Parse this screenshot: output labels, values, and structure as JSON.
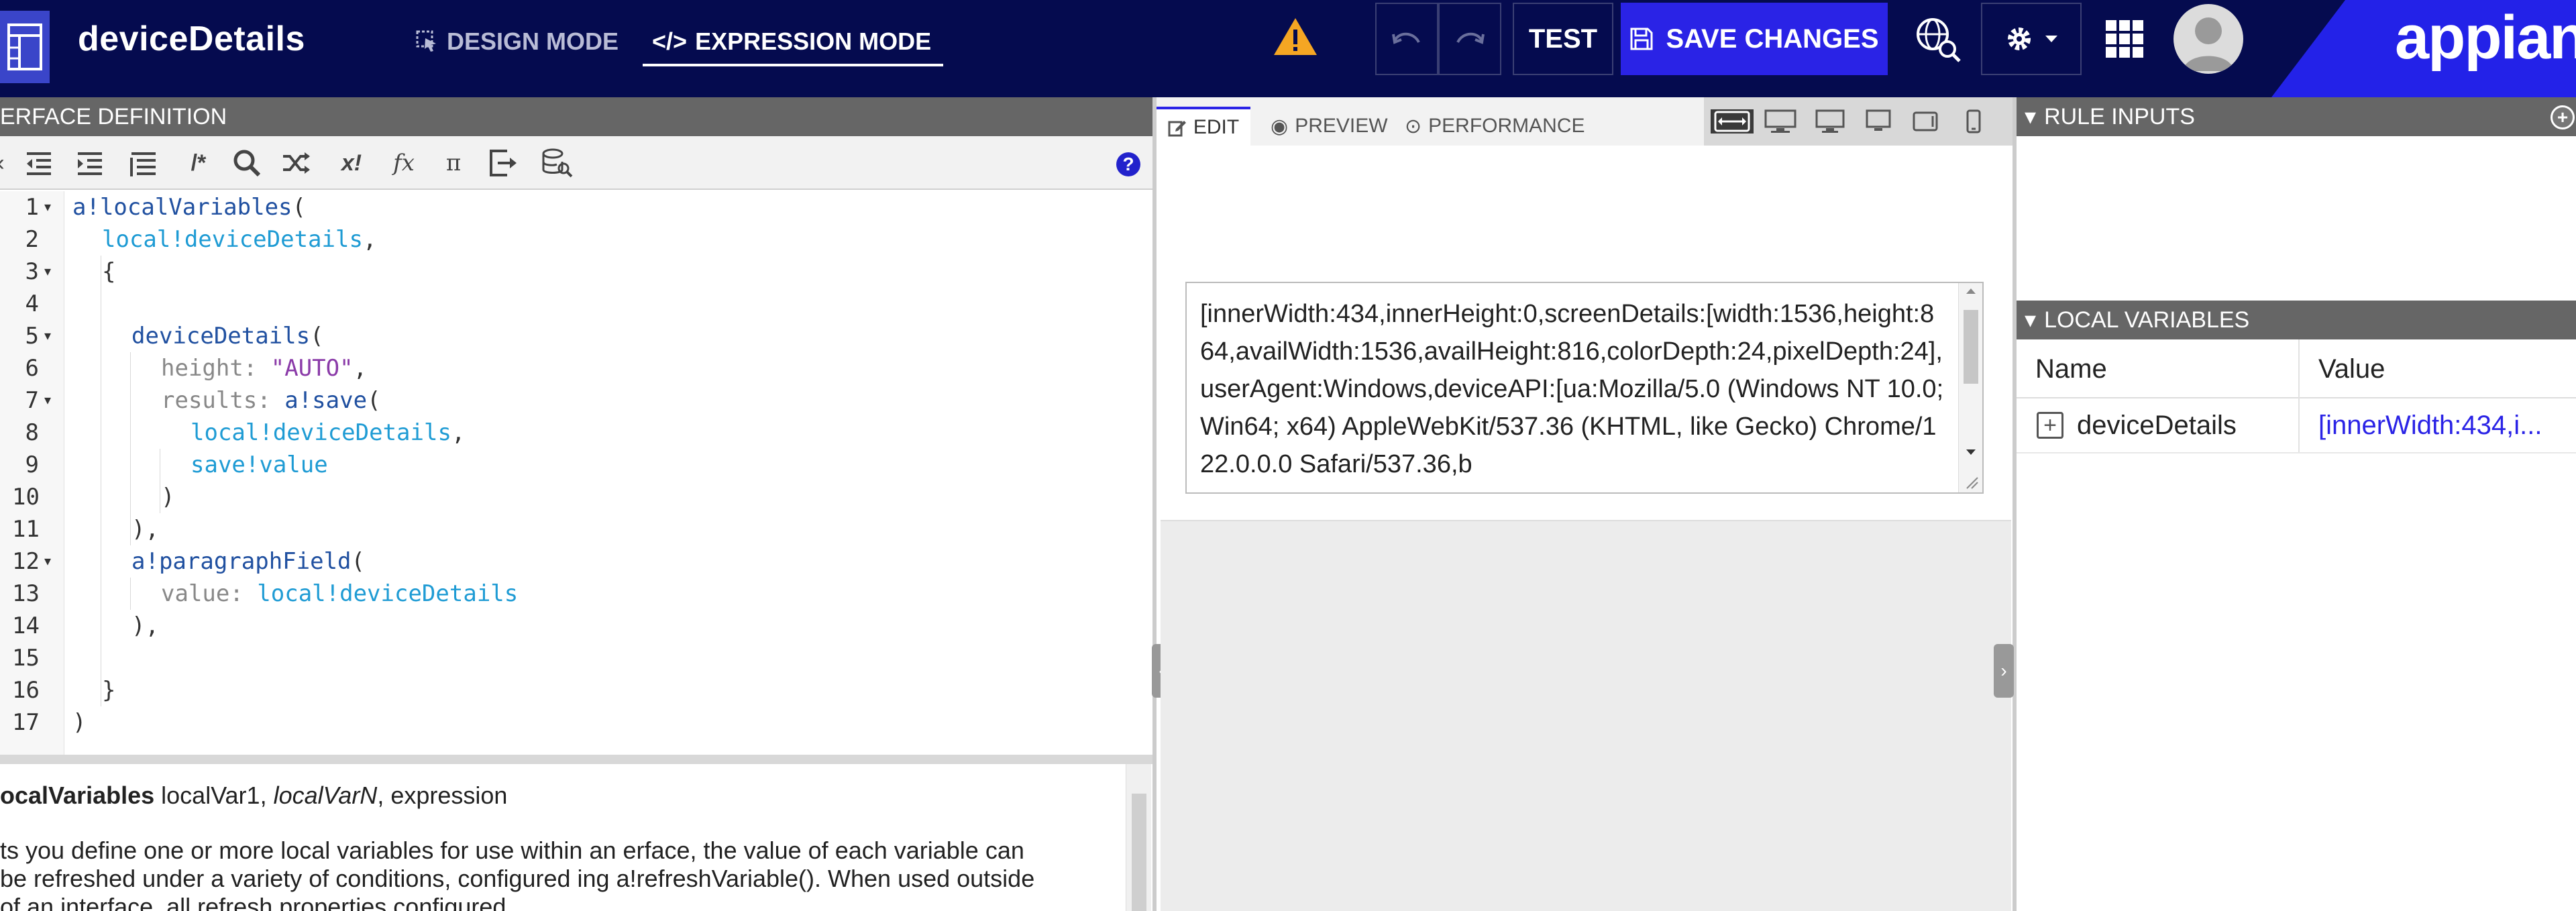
{
  "topbar": {
    "title": "deviceDetails",
    "design_mode": "DESIGN MODE",
    "expression_mode": "EXPRESSION MODE",
    "test": "TEST",
    "save": "SAVE CHANGES",
    "brand": "appian",
    "colors": {
      "bar": "#050b4f",
      "save": "#2a23e6",
      "warning": "#f5a623"
    }
  },
  "left": {
    "header": "ERFACE DEFINITION",
    "toolbar_icons": [
      "indent-icon",
      "outdent-icon",
      "indent-more-icon",
      "format-icon",
      "comment-icon",
      "search-icon",
      "shuffle-icon",
      "rule-icon",
      "function-icon",
      "pi-icon",
      "export-icon",
      "data-search-icon",
      "help-icon"
    ],
    "help_label": "?",
    "lines": [
      {
        "n": "1",
        "fold": "▾"
      },
      {
        "n": "2",
        "fold": ""
      },
      {
        "n": "3",
        "fold": "▾"
      },
      {
        "n": "4",
        "fold": ""
      },
      {
        "n": "5",
        "fold": "▾"
      },
      {
        "n": "6",
        "fold": ""
      },
      {
        "n": "7",
        "fold": "▾"
      },
      {
        "n": "8",
        "fold": ""
      },
      {
        "n": "9",
        "fold": ""
      },
      {
        "n": "10",
        "fold": ""
      },
      {
        "n": "11",
        "fold": ""
      },
      {
        "n": "12",
        "fold": "▾"
      },
      {
        "n": "13",
        "fold": ""
      },
      {
        "n": "14",
        "fold": ""
      },
      {
        "n": "15",
        "fold": ""
      },
      {
        "n": "16",
        "fold": ""
      },
      {
        "n": "17",
        "fold": ""
      }
    ],
    "code": {
      "l1_fn": "a!localVariables",
      "l1_p": "(",
      "l2_var": "local!deviceDetails",
      "l2_p": ",",
      "l3": "{",
      "l5_fn": "deviceDetails",
      "l5_p": "(",
      "l6_key": "height: ",
      "l6_str": "\"AUTO\"",
      "l6_p": ",",
      "l7_key": "results: ",
      "l7_fn": "a!save",
      "l7_p": "(",
      "l8_var": "local!deviceDetails",
      "l8_p": ",",
      "l9_var": "save!value",
      "l10": ")",
      "l11": "),",
      "l12_fn": "a!paragraphField",
      "l12_p": "(",
      "l13_key": "value: ",
      "l13_var": "local!deviceDetails",
      "l14": "),",
      "l16": "}",
      "l17": ")"
    },
    "doc": {
      "fn": "ocalVariables",
      "args_plain": " localVar1, ",
      "args_italic": "localVarN",
      "args_end": ", expression",
      "desc": "ts you define one or more local variables for use within an erface, the value of each variable can be refreshed under a variety of conditions, configured ing a!refreshVariable(). When used outside of an interface, all refresh properties configured"
    }
  },
  "middle": {
    "tabs": {
      "edit": "EDIT",
      "preview": "PREVIEW",
      "performance": "PERFORMANCE"
    },
    "paragraph": "[innerWidth:434,innerHeight:0,screenDetails:[width:1536,height:864,availWidth:1536,availHeight:816,colorDepth:24,pixelDepth:24],userAgent:Windows,deviceAPI:[ua:Mozilla/5.0 (Windows NT 10.0; Win64; x64) AppleWebKit/537.36 (KHTML, like Gecko) Chrome/122.0.0.0 Safari/537.36,b"
  },
  "right": {
    "rule_inputs": "RULE INPUTS",
    "local_variables": "LOCAL VARIABLES",
    "col_name": "Name",
    "col_value": "Value",
    "row_name": "deviceDetails",
    "row_value": "[innerWidth:434,i..."
  }
}
